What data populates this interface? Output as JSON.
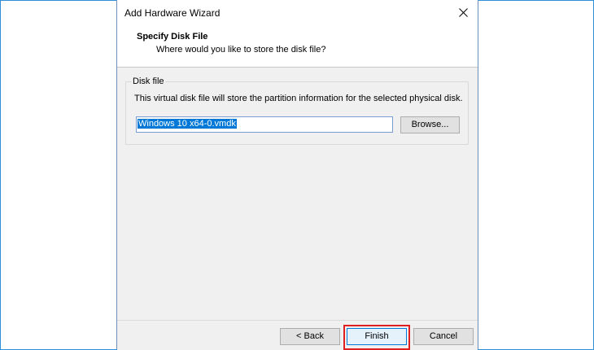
{
  "window": {
    "title": "Add Hardware Wizard",
    "close_icon": "close-icon"
  },
  "header": {
    "title": "Specify Disk File",
    "subtitle": "Where would you like to store the disk file?"
  },
  "disk_file": {
    "group_label": "Disk file",
    "description": "This virtual disk file will store the partition information for the selected physical disk.",
    "filename_value": "Windows 10 x64-0.vmdk",
    "browse_label": "Browse..."
  },
  "footer": {
    "back_label": "< Back",
    "finish_label": "Finish",
    "cancel_label": "Cancel"
  },
  "colors": {
    "accent": "#0078d7",
    "highlight_box": "#e02020",
    "page_border": "#2f8fd8"
  }
}
